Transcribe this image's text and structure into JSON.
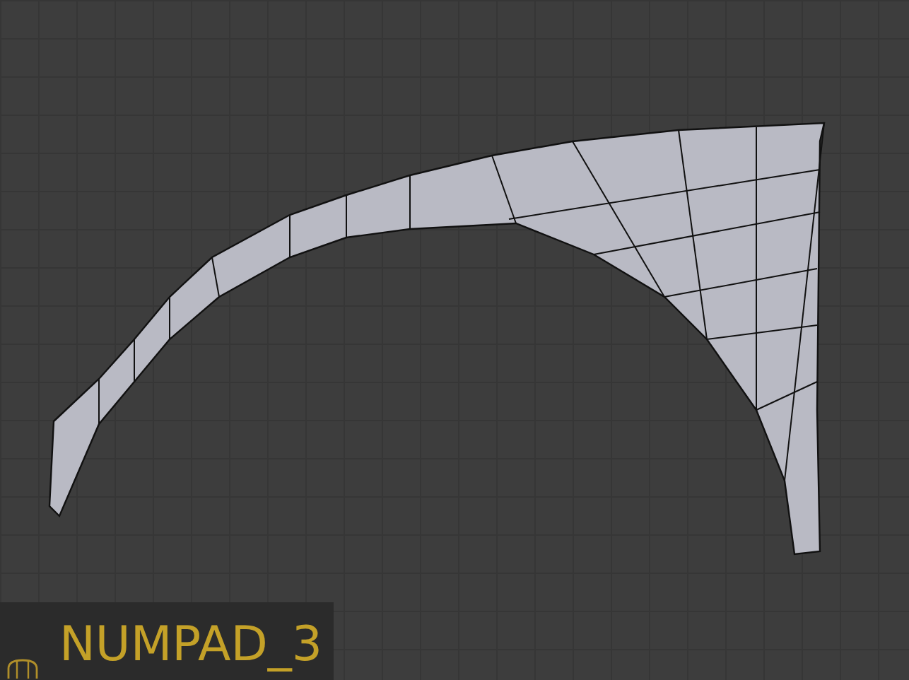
{
  "viewport": {
    "key_indicator": {
      "text": "NUMPAD_3"
    }
  }
}
